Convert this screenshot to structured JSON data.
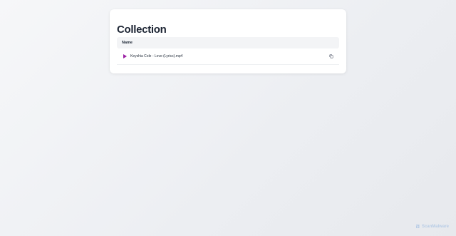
{
  "page": {
    "title": "Collection"
  },
  "table": {
    "header": {
      "name_label": "Name"
    },
    "rows": [
      {
        "file_name": "Keyshia Cole - Love (Lyrics).mp4",
        "play_icon": "play-icon",
        "copy_icon": "copy-icon"
      }
    ]
  },
  "watermark": {
    "text": "ScanMalware"
  },
  "colors": {
    "accent": "#9b1fa3",
    "title": "#1c2433",
    "header_bg": "#f3f4f6",
    "watermark": "#b9cde6"
  }
}
